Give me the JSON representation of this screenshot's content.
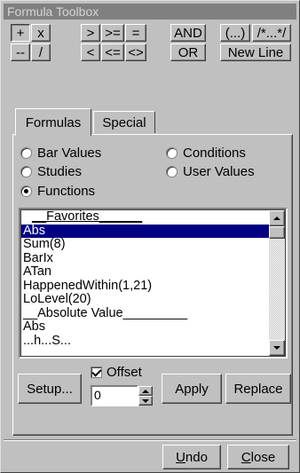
{
  "window": {
    "title": "Formula Toolbox"
  },
  "operators": {
    "row1": [
      "+",
      "x",
      ">",
      ">=",
      "=",
      "AND",
      "(...)",
      "/*...*/"
    ],
    "row2": [
      "--",
      "/",
      "<",
      "<=",
      "<>",
      "OR",
      "New Line"
    ]
  },
  "tabs": {
    "formulas": "Formulas",
    "special": "Special"
  },
  "radio": {
    "bar_values": "Bar Values",
    "conditions": "Conditions",
    "studies": "Studies",
    "user_values": "User Values",
    "functions": "Functions",
    "selected": "Functions"
  },
  "list": {
    "items": [
      {
        "text": "__Favorites______",
        "type": "header"
      },
      {
        "text": "Abs",
        "type": "item",
        "selected": true
      },
      {
        "text": "Sum(8)",
        "type": "item"
      },
      {
        "text": "BarIx",
        "type": "item"
      },
      {
        "text": "ATan",
        "type": "item"
      },
      {
        "text": "HappenedWithin(1,21)",
        "type": "item"
      },
      {
        "text": "LoLevel(20)",
        "type": "item"
      },
      {
        "text": "__Absolute Value_________",
        "type": "item"
      },
      {
        "text": "Abs",
        "type": "item"
      },
      {
        "text": "...h...S...",
        "type": "item"
      }
    ]
  },
  "controls": {
    "setup": "Setup...",
    "offset_label": "Offset",
    "offset_checked": true,
    "offset_value": "0",
    "apply": "Apply",
    "replace": "Replace",
    "undo": "Undo",
    "close": "Close"
  },
  "colors": {
    "face": "#c0c0c0",
    "selection": "#000080",
    "title_bar": "#808080"
  }
}
